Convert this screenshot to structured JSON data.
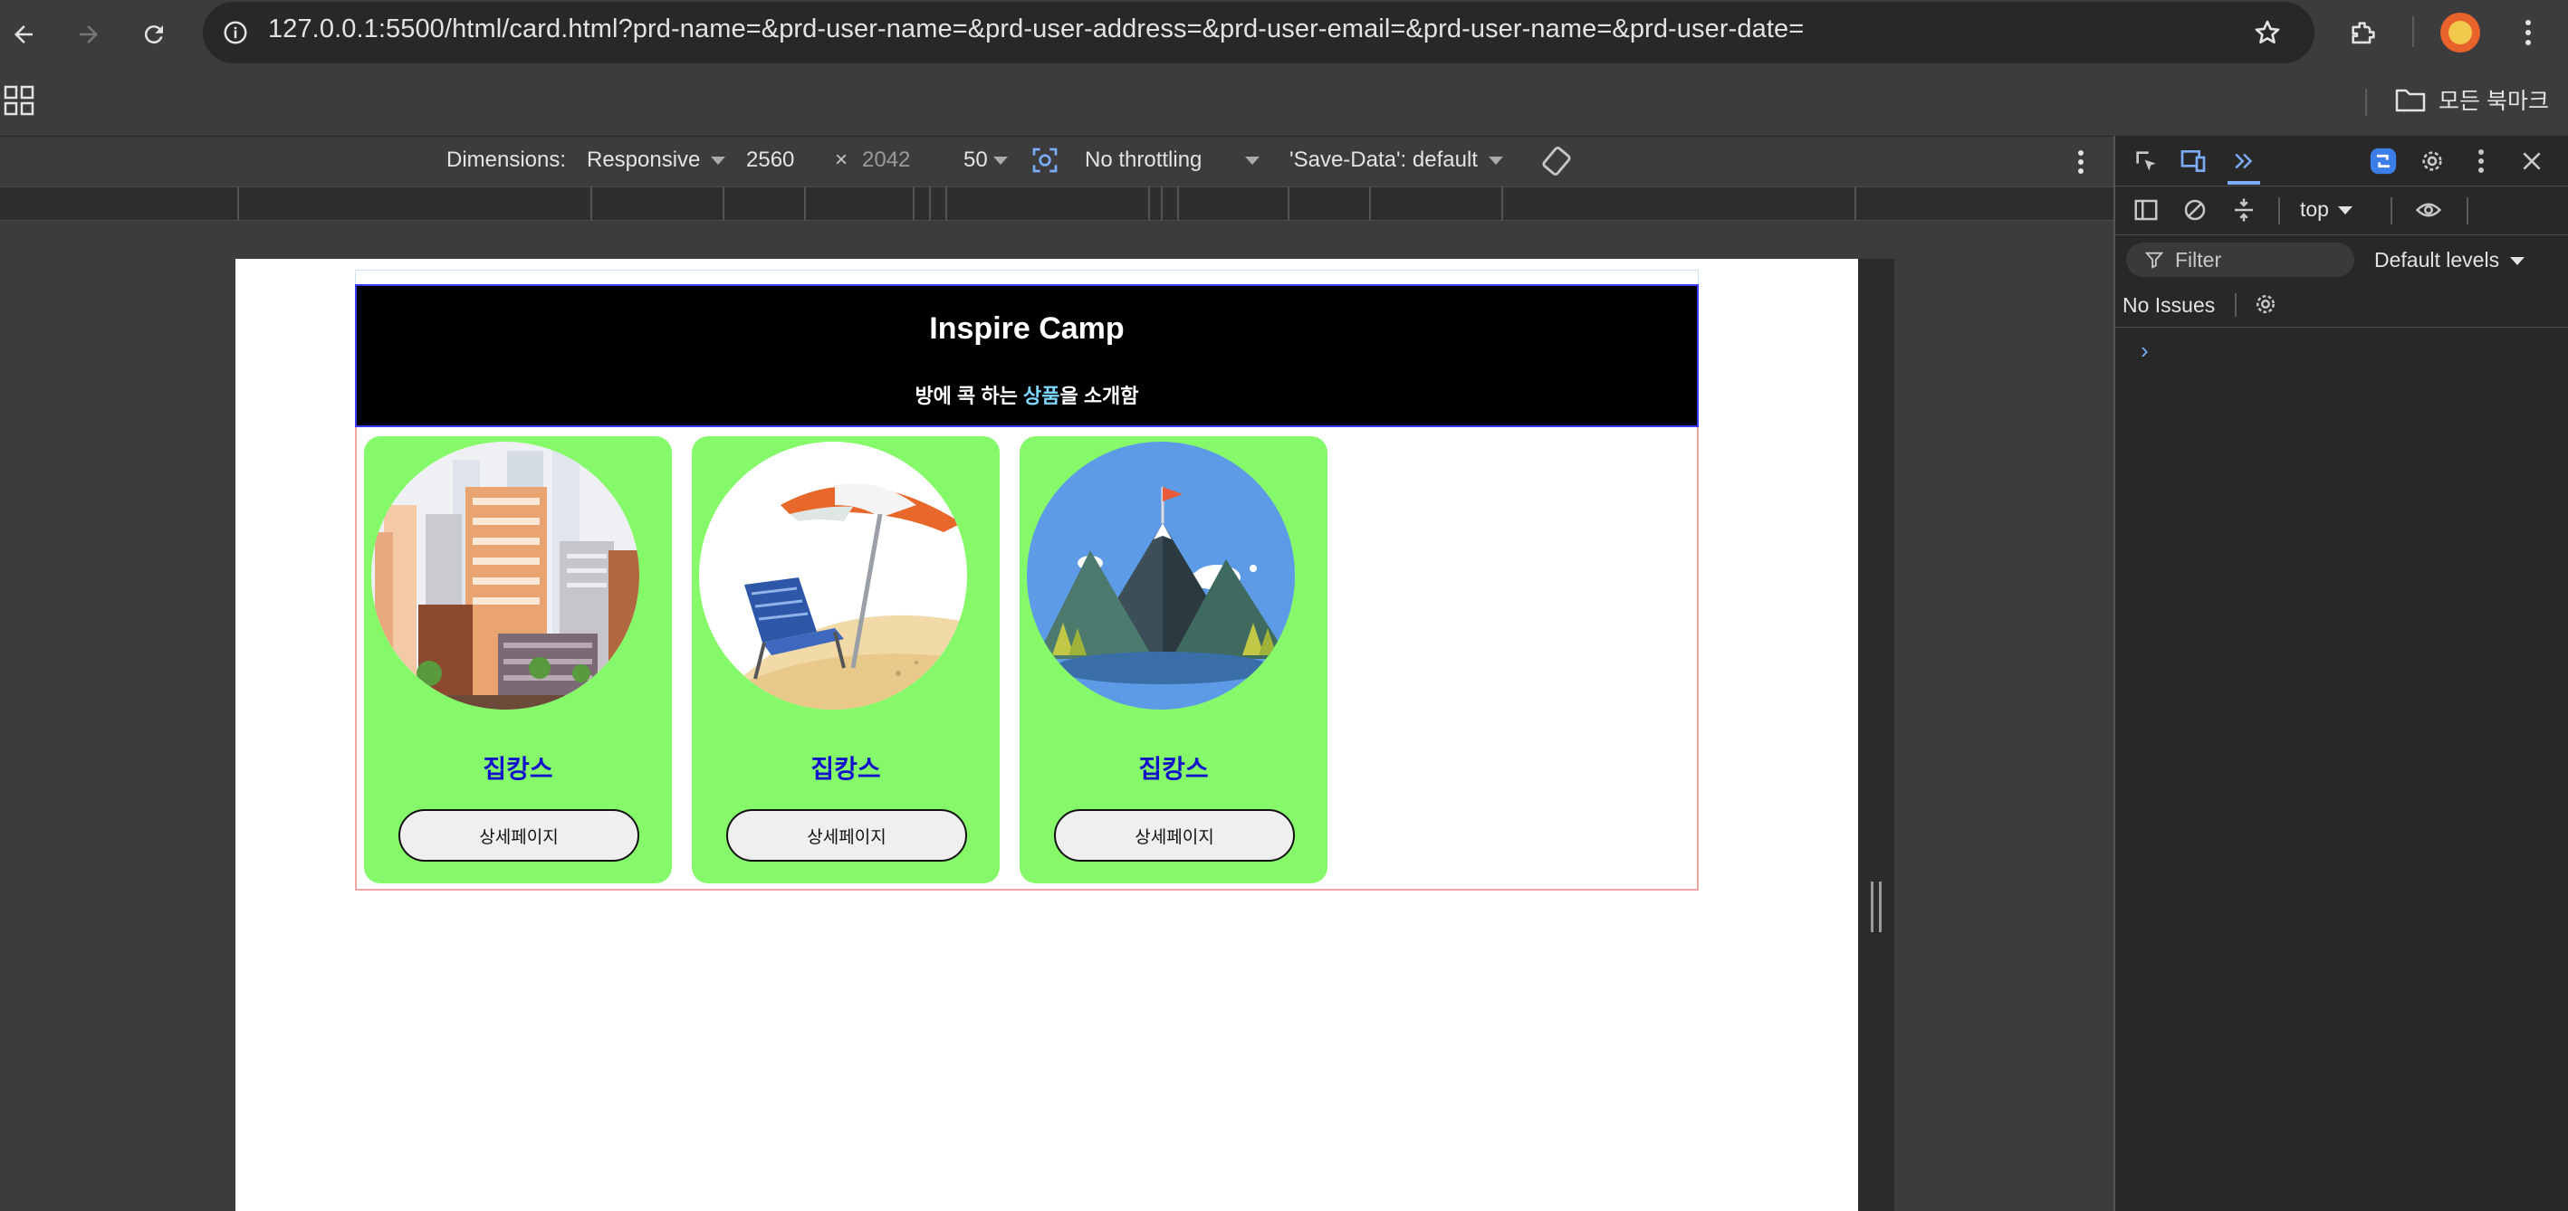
{
  "browser": {
    "url": "127.0.0.1:5500/html/card.html?prd-name=&prd-user-name=&prd-user-address=&prd-user-email=&prd-user-name=&prd-user-date=",
    "bookmarks_label": "모든 북마크"
  },
  "device_toolbar": {
    "dimensions_label": "Dimensions:",
    "mode": "Responsive",
    "width": "2560",
    "times": "×",
    "height": "2042",
    "zoom": "50",
    "throttling": "No throttling",
    "save_data": "'Save-Data': default"
  },
  "page": {
    "title": "Inspire Camp",
    "subtitle_pre": "방에 콕 하는 ",
    "subtitle_highlight": "상품",
    "subtitle_post": "을 소개함",
    "cards": [
      {
        "title": "집캉스",
        "button": "상세페이지",
        "image": "city-illustration"
      },
      {
        "title": "집캉스",
        "button": "상세페이지",
        "image": "beach-illustration"
      },
      {
        "title": "집캉스",
        "button": "상세페이지",
        "image": "mountain-illustration"
      }
    ]
  },
  "devtools": {
    "context": "top",
    "filter_placeholder": "Filter",
    "levels": "Default levels",
    "issues": "No Issues",
    "prompt": "›"
  }
}
